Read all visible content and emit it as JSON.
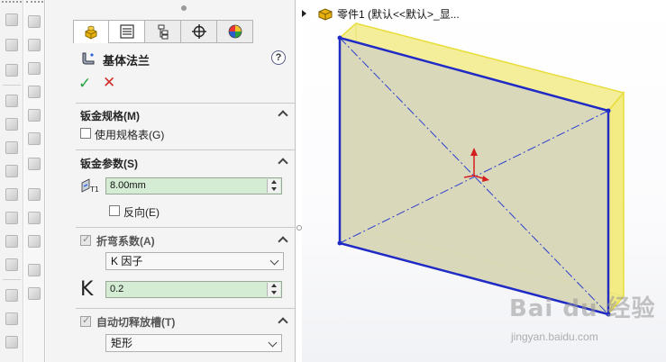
{
  "icons": {
    "toolbar_left": [
      "edge-flange-icon",
      "hem-icon",
      "jog-icon",
      "sketched-bend-icon",
      "cross-break-icon",
      "lofted-bend-icon",
      "corner-icon",
      "tab-icon",
      "unfold-icon",
      "fold-icon",
      "flatten-icon",
      "forming-tool-icon",
      "rip-icon",
      "insert-bends-icon",
      "convert-icon",
      "vent-icon"
    ],
    "toolbar_second": [
      "extrude-icon",
      "revolve-icon",
      "sweep-icon",
      "loft-icon",
      "shell-icon",
      "draft-icon",
      "rib-icon",
      "wrap-icon",
      "dome-icon",
      "cut-icon",
      "hole-icon",
      "fillet-icon",
      "chamfer-icon",
      "mirror-icon"
    ]
  },
  "pm": {
    "tabs": [
      "feature-manager-tab",
      "property-manager-tab",
      "configuration-manager-tab",
      "dim-xpert-tab",
      "display-manager-tab"
    ],
    "title": "基体法兰",
    "help": "?",
    "ok": "✓",
    "cancel": "✕",
    "groups": {
      "gauge": {
        "title": "钣金规格(M)",
        "use_gauge_table": "使用规格表(G)"
      },
      "params": {
        "title": "钣金参数(S)",
        "thickness": "8.00mm",
        "reverse": "反向(E)"
      },
      "bend": {
        "title": "折弯系数(A)",
        "type": "K 因子",
        "k_label": "K",
        "k_value": "0.2"
      },
      "relief": {
        "title": "自动切释放槽(T)",
        "type": "矩形"
      }
    }
  },
  "viewport": {
    "tree_label": "零件1  (默认<<默认>_显..."
  },
  "colors": {
    "field_bg": "#d4ecd4",
    "model_fill": "#d7d5b4",
    "model_edge": "#1f2bc4",
    "model_side": "#f3ec84"
  },
  "watermark": {
    "main": "Bai du 经验",
    "sub": "jingyan.baidu.com"
  }
}
